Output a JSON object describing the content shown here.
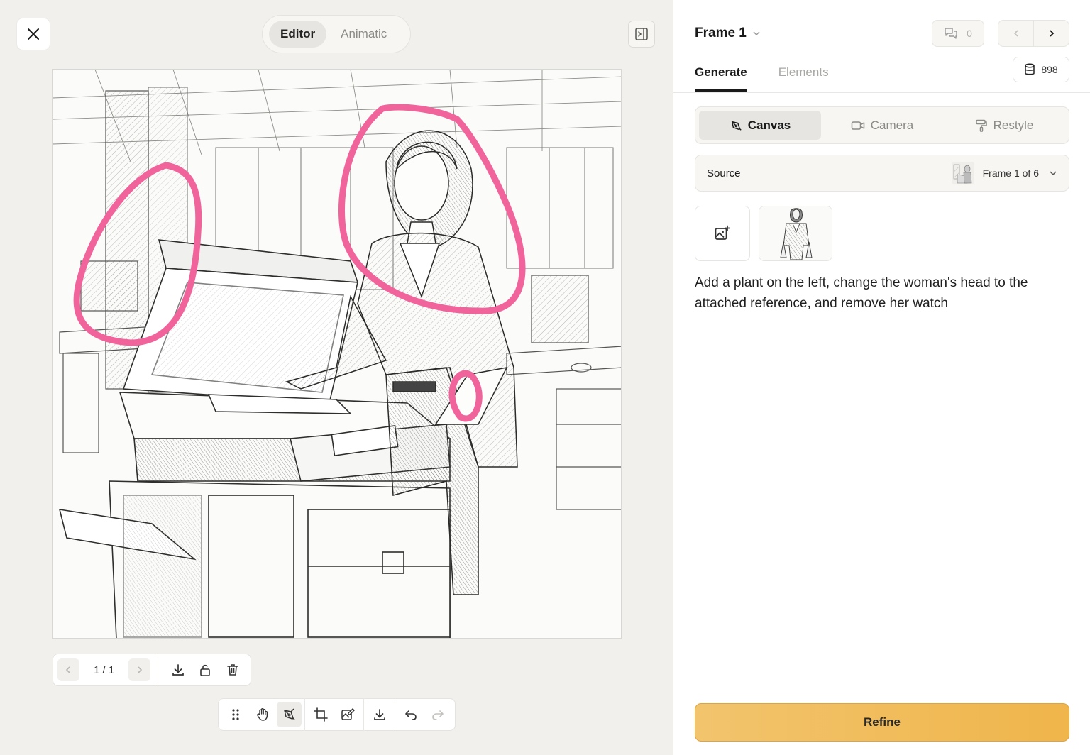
{
  "editor": {
    "modes": [
      {
        "label": "Editor",
        "active": true
      },
      {
        "label": "Animatic",
        "active": false
      }
    ],
    "pager": {
      "count": "1 / 1"
    },
    "annotation_color": "#f0649b"
  },
  "panel": {
    "frame_title": "Frame 1",
    "comments_count": "0",
    "credits": "898",
    "tabs": [
      {
        "label": "Generate",
        "active": true
      },
      {
        "label": "Elements",
        "active": false
      }
    ],
    "modes": [
      {
        "label": "Canvas",
        "icon": "pen-tool-icon",
        "active": true
      },
      {
        "label": "Camera",
        "icon": "video-camera-icon",
        "active": false
      },
      {
        "label": "Restyle",
        "icon": "paint-roller-icon",
        "active": false
      }
    ],
    "source": {
      "label": "Source",
      "value": "Frame 1 of 6"
    },
    "prompt": "Add a plant on the left, change the woman's head to the attached reference, and remove her watch",
    "refine_label": "Refine",
    "accent_color": "#f0b54b"
  }
}
